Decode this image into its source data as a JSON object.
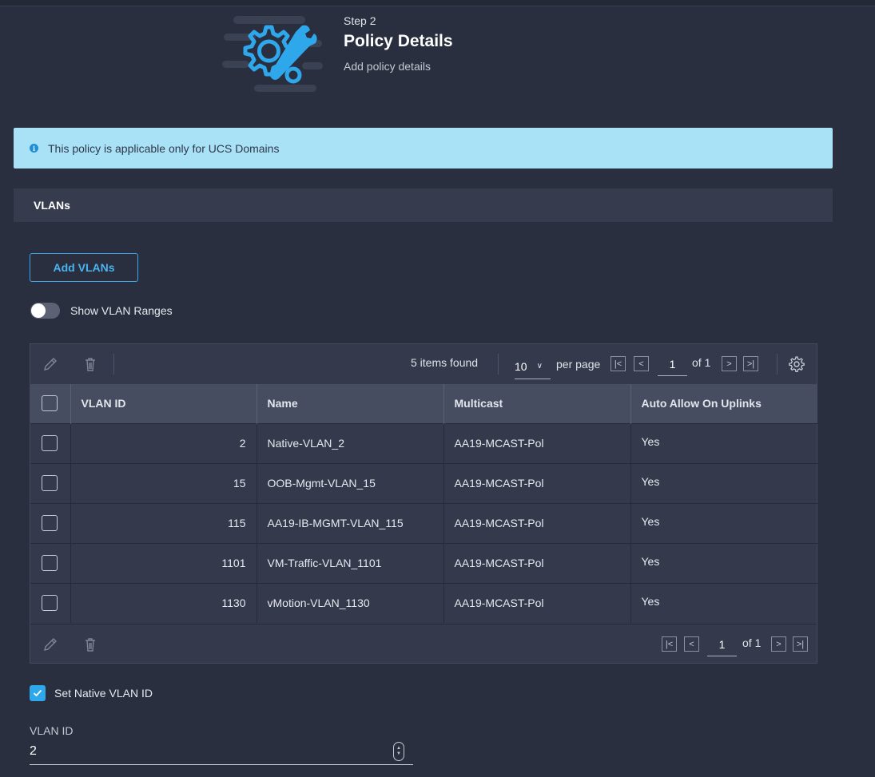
{
  "header": {
    "step": "Step 2",
    "title": "Policy Details",
    "subtitle": "Add policy details",
    "icon": "gear-wrench-icon"
  },
  "banner": {
    "text": "This policy is applicable only for UCS Domains",
    "icon": "info-icon",
    "color": "#a9e2f7"
  },
  "section": {
    "title": "VLANs"
  },
  "actions": {
    "add_label": "Add VLANs"
  },
  "toggle": {
    "label": "Show VLAN Ranges",
    "on": false
  },
  "table": {
    "items_found": "5 items found",
    "per_page_value": "10",
    "per_page_label": "per page",
    "page": "1",
    "of_pages": "of 1",
    "columns": [
      "VLAN ID",
      "Name",
      "Multicast",
      "Auto Allow On Uplinks"
    ],
    "rows": [
      {
        "vlan_id": "2",
        "name": "Native-VLAN_2",
        "multicast": "AA19-MCAST-Pol",
        "auto_allow": "Yes"
      },
      {
        "vlan_id": "15",
        "name": "OOB-Mgmt-VLAN_15",
        "multicast": "AA19-MCAST-Pol",
        "auto_allow": "Yes"
      },
      {
        "vlan_id": "115",
        "name": "AA19-IB-MGMT-VLAN_115",
        "multicast": "AA19-MCAST-Pol",
        "auto_allow": "Yes"
      },
      {
        "vlan_id": "1101",
        "name": "VM-Traffic-VLAN_1101",
        "multicast": "AA19-MCAST-Pol",
        "auto_allow": "Yes"
      },
      {
        "vlan_id": "1130",
        "name": "vMotion-VLAN_1130",
        "multicast": "AA19-MCAST-Pol",
        "auto_allow": "Yes"
      }
    ]
  },
  "native": {
    "checkbox_label": "Set Native VLAN ID",
    "checked": true,
    "field_label": "VLAN ID",
    "field_value": "2"
  },
  "colors": {
    "background": "#2a2f3f",
    "accent": "#2ea7eb",
    "header_row": "#474d60"
  }
}
